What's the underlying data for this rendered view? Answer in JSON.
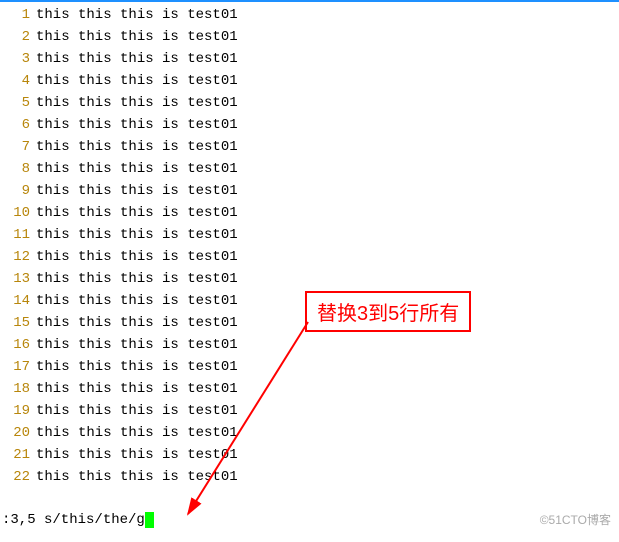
{
  "lines": [
    {
      "num": "1",
      "text": "this this this is test01"
    },
    {
      "num": "2",
      "text": "this this this is test01"
    },
    {
      "num": "3",
      "text": "this this this is test01"
    },
    {
      "num": "4",
      "text": "this this this is test01"
    },
    {
      "num": "5",
      "text": "this this this is test01"
    },
    {
      "num": "6",
      "text": "this this this is test01"
    },
    {
      "num": "7",
      "text": "this this this is test01"
    },
    {
      "num": "8",
      "text": "this this this is test01"
    },
    {
      "num": "9",
      "text": "this this this is test01"
    },
    {
      "num": "10",
      "text": "this this this is test01"
    },
    {
      "num": "11",
      "text": "this this this is test01"
    },
    {
      "num": "12",
      "text": "this this this is test01"
    },
    {
      "num": "13",
      "text": "this this this is test01"
    },
    {
      "num": "14",
      "text": "this this this is test01"
    },
    {
      "num": "15",
      "text": "this this this is test01"
    },
    {
      "num": "16",
      "text": "this this this is test01"
    },
    {
      "num": "17",
      "text": "this this this is test01"
    },
    {
      "num": "18",
      "text": "this this this is test01"
    },
    {
      "num": "19",
      "text": "this this this is test01"
    },
    {
      "num": "20",
      "text": "this this this is test01"
    },
    {
      "num": "21",
      "text": "this this this is test01"
    },
    {
      "num": "22",
      "text": "this this this is test01"
    }
  ],
  "command": ":3,5 s/this/the/g",
  "annotation": "替换3到5行所有",
  "watermark": "©51CTO博客"
}
